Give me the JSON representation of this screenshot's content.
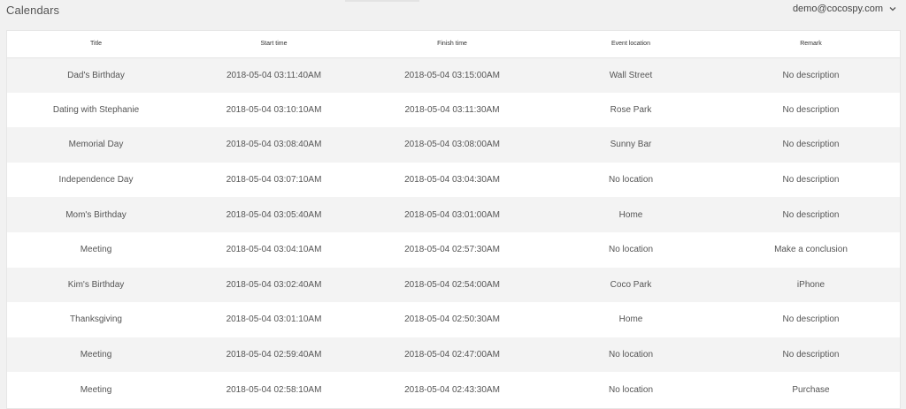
{
  "header": {
    "title": "Calendars",
    "account_email": "demo@cocospy.com",
    "account_icon": "chevron-down-icon"
  },
  "table": {
    "columns": [
      "Title",
      "Start time",
      "Finish time",
      "Event location",
      "Remark"
    ],
    "rows": [
      [
        "Dad's Birthday",
        "2018-05-04 03:11:40AM",
        "2018-05-04 03:15:00AM",
        "Wall Street",
        "No description"
      ],
      [
        "Dating with Stephanie",
        "2018-05-04 03:10:10AM",
        "2018-05-04 03:11:30AM",
        "Rose Park",
        "No description"
      ],
      [
        "Memorial Day",
        "2018-05-04 03:08:40AM",
        "2018-05-04 03:08:00AM",
        "Sunny Bar",
        "No description"
      ],
      [
        "Independence Day",
        "2018-05-04 03:07:10AM",
        "2018-05-04 03:04:30AM",
        "No location",
        "No description"
      ],
      [
        "Mom's Birthday",
        "2018-05-04 03:05:40AM",
        "2018-05-04 03:01:00AM",
        "Home",
        "No description"
      ],
      [
        "Meeting",
        "2018-05-04 03:04:10AM",
        "2018-05-04 02:57:30AM",
        "No location",
        "Make a conclusion"
      ],
      [
        "Kim's Birthday",
        "2018-05-04 03:02:40AM",
        "2018-05-04 02:54:00AM",
        "Coco Park",
        "iPhone"
      ],
      [
        "Thanksgiving",
        "2018-05-04 03:01:10AM",
        "2018-05-04 02:50:30AM",
        "Home",
        "No description"
      ],
      [
        "Meeting",
        "2018-05-04 02:59:40AM",
        "2018-05-04 02:47:00AM",
        "No location",
        "No description"
      ],
      [
        "Meeting",
        "2018-05-04 02:58:10AM",
        "2018-05-04 02:43:30AM",
        "No location",
        "Purchase"
      ]
    ]
  }
}
